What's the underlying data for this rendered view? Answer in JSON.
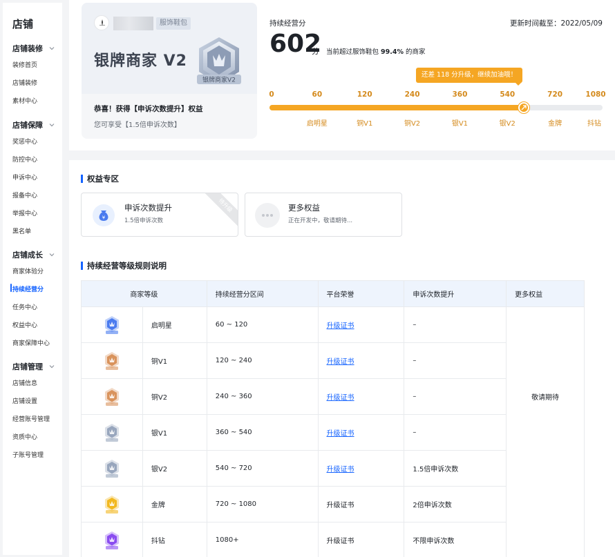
{
  "sidebar": {
    "title": "店铺",
    "groups": [
      {
        "label": "店铺装修",
        "items": [
          "装修首页",
          "店铺装修",
          "素材中心"
        ]
      },
      {
        "label": "店铺保障",
        "items": [
          "奖惩中心",
          "防控中心",
          "申诉中心",
          "报备中心",
          "举报中心",
          "黑名单"
        ]
      },
      {
        "label": "店铺成长",
        "items": [
          "商家体验分",
          "持续经营分",
          "任务中心",
          "权益中心",
          "商家保障中心"
        ]
      },
      {
        "label": "店铺管理",
        "items": [
          "店铺信息",
          "店铺设置",
          "经营账号管理",
          "资质中心",
          "子账号管理"
        ]
      }
    ],
    "active_item": "持续经营分"
  },
  "badge_card": {
    "category_tag": "服饰鞋包",
    "level_title": "银牌商家 V2",
    "badge_text": "银牌商家V2",
    "congrats_title": "恭喜！获得【申诉次数提升】权益",
    "congrats_sub": "您可享受【1.5倍申诉次数】"
  },
  "score": {
    "label": "持续经营分",
    "update_time": "更新时间截至：2022/05/09",
    "value": "602",
    "unit": "分",
    "desc_prefix": "当前超过服饰鞋包",
    "desc_percent": "99.4%",
    "desc_suffix": "的商家",
    "tip": "还差 118 分升级，继续加油哦！",
    "progress_value": 602,
    "ticks": [
      "0",
      "60",
      "120",
      "240",
      "360",
      "540",
      "720",
      "1080"
    ],
    "levels": [
      "启明星",
      "铜V1",
      "铜V2",
      "银V1",
      "银V2",
      "金牌",
      "抖钻"
    ]
  },
  "benefits": {
    "section_title": "权益专区",
    "cards": [
      {
        "title": "申诉次数提升",
        "sub": "1.5倍申诉次数",
        "ribbon": "待升级"
      },
      {
        "title": "更多权益",
        "sub": "正在开发中，敬请期待..."
      }
    ]
  },
  "rules": {
    "section_title": "持续经营等级规则说明",
    "headers": [
      "商家等级",
      "持续经营分区间",
      "平台荣誉",
      "申诉次数提升",
      "更多权益"
    ],
    "more_benefits": "敬请期待",
    "rows": [
      {
        "level": "启明星",
        "range": "60 ~ 120",
        "honor": "升级证书",
        "appeal": "–",
        "color": "#4a7bef"
      },
      {
        "level": "铜V1",
        "range": "120 ~ 240",
        "honor": "升级证书",
        "appeal": "–",
        "color": "#d9935c"
      },
      {
        "level": "铜V2",
        "range": "240 ~ 360",
        "honor": "升级证书",
        "appeal": "–",
        "color": "#d9935c"
      },
      {
        "level": "银V1",
        "range": "360 ~ 540",
        "honor": "升级证书",
        "appeal": "–",
        "color": "#98a6bd"
      },
      {
        "level": "银V2",
        "range": "540 ~ 720",
        "honor": "升级证书",
        "appeal": "1.5倍申诉次数",
        "color": "#98a6bd"
      },
      {
        "level": "金牌",
        "range": "720 ~ 1080",
        "honor": "升级证书",
        "appeal": "2倍申诉次数",
        "color": "#f2b81f"
      },
      {
        "level": "抖钻",
        "range": "1080+",
        "honor": "升级证书",
        "appeal": "不限申诉次数",
        "color": "#8a4cf0"
      }
    ]
  },
  "colors": {
    "accent": "#1664ff",
    "orange": "#f5a623",
    "orange_text": "#d48a1c"
  },
  "icons": [
    "chevron-down-icon",
    "store-logo-icon",
    "silver-shield-badge-icon",
    "arrow-up-right-icon",
    "money-bag-icon",
    "more-dots-icon",
    "level-badge-icon"
  ]
}
